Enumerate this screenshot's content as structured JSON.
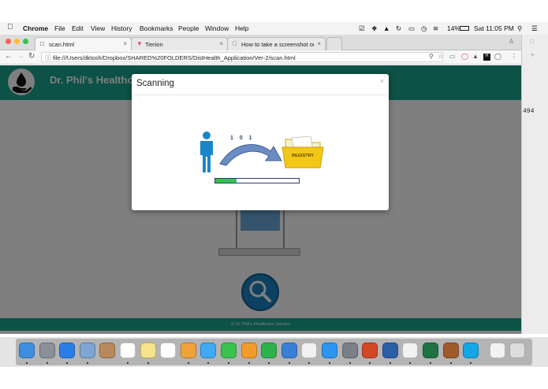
{
  "menubar": {
    "app_name": "Chrome",
    "items": [
      "File",
      "Edit",
      "View",
      "History",
      "Bookmarks",
      "People",
      "Window",
      "Help"
    ],
    "battery": "14%",
    "clock": "Sat 11:05 PM"
  },
  "browser": {
    "tabs": [
      {
        "title": "scan.html",
        "active": true
      },
      {
        "title": "Tierion",
        "active": false
      },
      {
        "title": "How to take a screenshot on y",
        "active": false
      }
    ],
    "url": "file:///Users/dktosh/Dropbox/SHARED%20FOLDERS/DistHealth_Application/Ver-2/scan.html"
  },
  "app": {
    "brand": "Dr. Phil's Healthca",
    "footer": "© Dr. Phil's Healthcare Service",
    "header_color": "#19a48c"
  },
  "modal": {
    "title": "Scanning",
    "close_glyph": "×",
    "binary_label": "1 0 1",
    "folder_label": "REGISTRY",
    "progress_percent": 25
  },
  "background_window": {
    "number": "494"
  },
  "dock": {
    "icons": [
      "finder-icon",
      "launchpad-icon",
      "safari-icon",
      "preview-icon",
      "contacts-icon",
      "calendar-icon",
      "notes-icon",
      "reminders-icon",
      "photos-icon",
      "messages-icon",
      "facetime-icon",
      "pages-icon",
      "numbers-icon",
      "keynote-icon",
      "itunes-icon",
      "app-store-icon",
      "system-preferences-icon",
      "powerpoint-icon",
      "screen-sharing-icon",
      "chrome-icon",
      "excel-icon",
      "game-icon",
      "skype-icon",
      "document-icon",
      "trash-icon"
    ]
  }
}
